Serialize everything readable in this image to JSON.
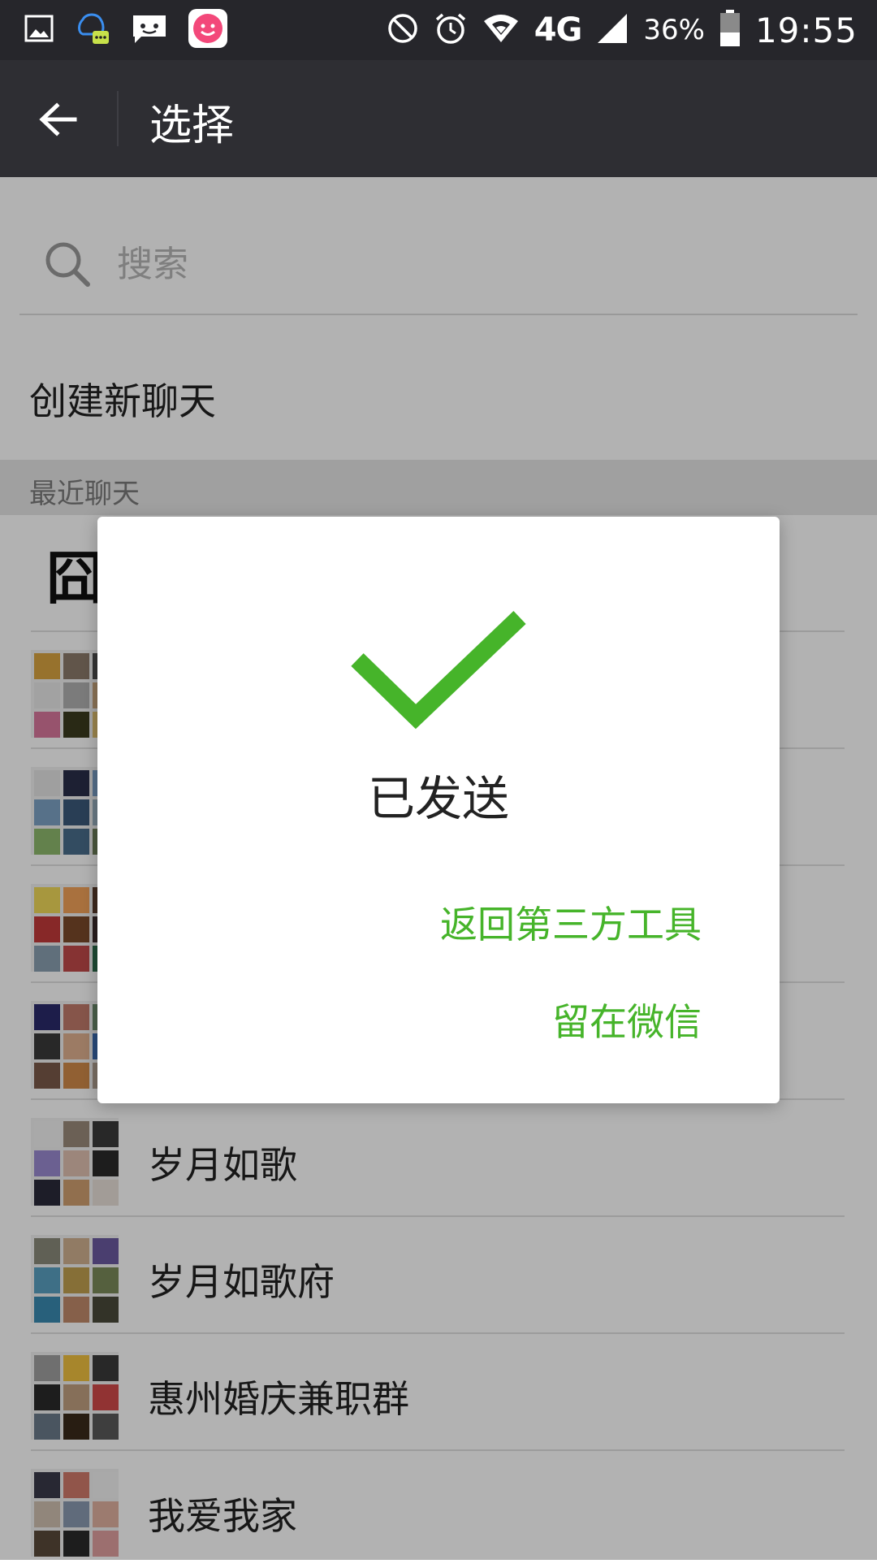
{
  "status_bar": {
    "time": "19:55",
    "battery_percent_label": "36%",
    "network_label": "4G",
    "left_icons": [
      "image-icon",
      "qq-message-icon",
      "sms-icon",
      "app-smiley-icon"
    ],
    "right_icons": [
      "do-not-disturb-icon",
      "alarm-icon",
      "wifi-icon",
      "signal-icon",
      "battery-icon"
    ]
  },
  "app_bar": {
    "title": "选择",
    "back_icon": "arrow-left-icon"
  },
  "search": {
    "placeholder": "搜索",
    "icon": "search-icon"
  },
  "create_new": "创建新聊天",
  "recent_header": "最近聊天",
  "chats": [
    {
      "name": "",
      "avatar": "single"
    },
    {
      "name": "",
      "avatar": "grid"
    },
    {
      "name": "",
      "avatar": "grid"
    },
    {
      "name": "",
      "avatar": "grid"
    },
    {
      "name": "",
      "avatar": "grid"
    },
    {
      "name": "岁月如歌",
      "avatar": "grid"
    },
    {
      "name": "岁月如歌府",
      "avatar": "grid"
    },
    {
      "name": "惠州婚庆兼职群",
      "avatar": "grid"
    },
    {
      "name": "我爱我家",
      "avatar": "grid"
    }
  ],
  "dialog": {
    "icon": "checkmark-icon",
    "message": "已发送",
    "return_button": "返回第三方工具",
    "stay_button": "留在微信"
  },
  "colors": {
    "status_bar": "#26262b",
    "app_bar": "#2e2e33",
    "accent_green": "#46b42a",
    "scrim": "rgba(0,0,0,0.30)"
  }
}
